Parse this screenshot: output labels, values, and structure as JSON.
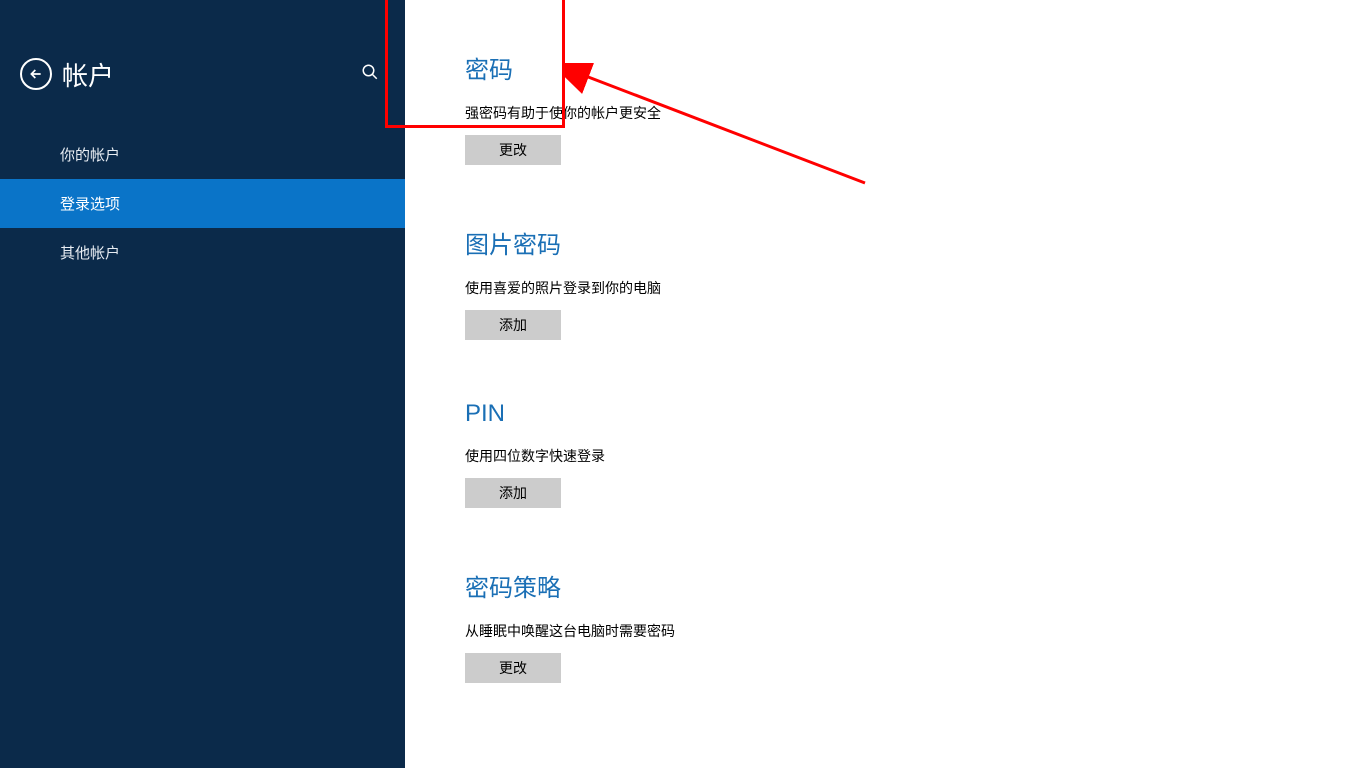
{
  "sidebar": {
    "title": "帐户",
    "items": [
      {
        "label": "你的帐户"
      },
      {
        "label": "登录选项"
      },
      {
        "label": "其他帐户"
      }
    ]
  },
  "sections": {
    "password": {
      "title": "密码",
      "desc": "强密码有助于使你的帐户更安全",
      "button": "更改"
    },
    "picture_password": {
      "title": "图片密码",
      "desc": "使用喜爱的照片登录到你的电脑",
      "button": "添加"
    },
    "pin": {
      "title": "PIN",
      "desc": "使用四位数字快速登录",
      "button": "添加"
    },
    "password_policy": {
      "title": "密码策略",
      "desc": "从睡眠中唤醒这台电脑时需要密码",
      "button": "更改"
    }
  }
}
